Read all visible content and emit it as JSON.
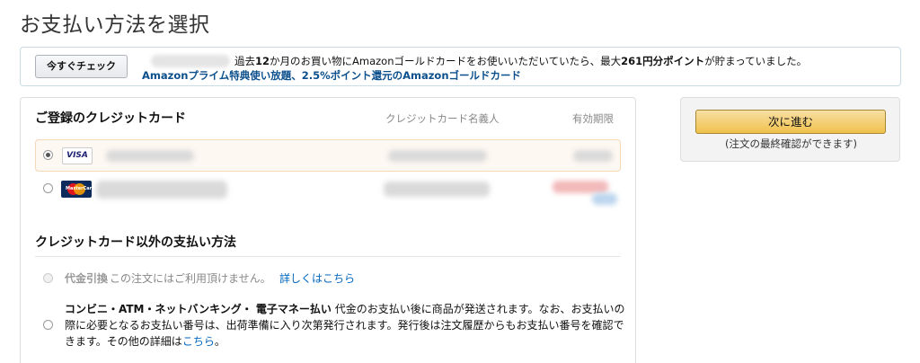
{
  "page": {
    "title": "お支払い方法を選択"
  },
  "promo": {
    "check_button": "今すぐチェック",
    "line1_pre": "過去",
    "line1_months": "12",
    "line1_mid": "か月のお買い物にAmazonゴールドカードをお使いいただいていたら、最大",
    "line1_points": "261円分ポイント",
    "line1_post": "が貯まっていました。",
    "line2": "Amazonプライム特典使い放題、2.5%ポイント還元のAmazonゴールドカード"
  },
  "cards": {
    "title": "ご登録のクレジットカード",
    "col_holder": "クレジットカード名義人",
    "col_expiry": "有効期限",
    "items": [
      {
        "brand": "VISA",
        "selected": true
      },
      {
        "brand": "MasterCard",
        "selected": false
      }
    ]
  },
  "other": {
    "title": "クレジットカード以外の支払い方法",
    "cod_label": "代金引換",
    "cod_note": "この注文にはご利用頂けません。",
    "cod_link": "詳しくはこちら",
    "conv_label": "コンビニ・ATM・ネットバンキング・ 電子マネー払い",
    "conv_text": " 代金のお支払い後に商品が発送されます。なお、お支払いの際に必要となるお支払い番号は、出荷準備に入り次第発行されます。発行後は注文履歴からもお支払い番号を確認できます。その他の詳細は",
    "conv_link": "こちら",
    "conv_end": "。"
  },
  "sidebar": {
    "next_button": "次に進む",
    "next_note": "(注文の最終確認ができます)"
  },
  "colors": {
    "link": "#0066c0",
    "promo_link": "#0b4f8c",
    "primary_button": "#f0c14b",
    "selected_row": "#fef8f2"
  }
}
